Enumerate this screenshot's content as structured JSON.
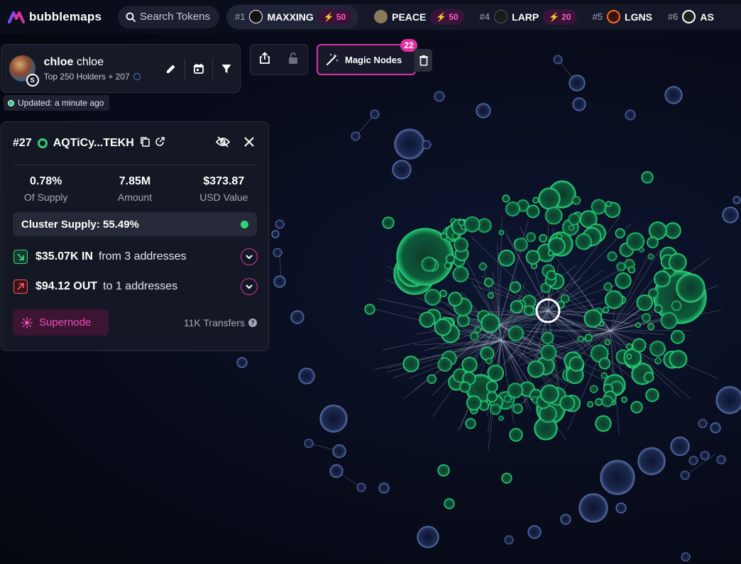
{
  "app": {
    "name": "bubblemaps",
    "search_placeholder": "Search Tokens"
  },
  "trending": [
    {
      "rank": "#1",
      "symbol": "MAXXING",
      "boost": "50",
      "logo_color": "#ffffff",
      "logo_bg": "#111111"
    },
    {
      "rank": "",
      "symbol": "PEACE",
      "boost": "50",
      "logo_color": "#c9b58a",
      "logo_bg": "#6a5e48"
    },
    {
      "rank": "#4",
      "symbol": "LARP",
      "boost": "20",
      "logo_color": "#ffffff",
      "logo_bg": "#1a1a1a"
    },
    {
      "rank": "#5",
      "symbol": "LGNS",
      "boost": "",
      "logo_color": "#ff6a2a",
      "logo_bg": "#3a1208"
    },
    {
      "rank": "#6",
      "symbol": "AS",
      "boost": "",
      "logo_color": "#ffffff",
      "logo_bg": "#222222"
    }
  ],
  "profile": {
    "name": "chloe",
    "ticker": "chloe",
    "subtitle": "Top 250 Holders + 207",
    "chain_badge": "S",
    "updated": "Updated: a minute ago"
  },
  "magic_nodes": {
    "label": "Magic Nodes",
    "count": "22"
  },
  "details": {
    "rank": "#27",
    "address": "AQTiCy...TEKH",
    "stats": [
      {
        "value": "0.78%",
        "label": "Of Supply"
      },
      {
        "value": "7.85M",
        "label": "Amount"
      },
      {
        "value": "$373.87",
        "label": "USD Value"
      }
    ],
    "cluster_supply": "Cluster Supply: 55.49%",
    "inflow": {
      "amount": "$35.07K IN",
      "text": "from 3 addresses"
    },
    "outflow": {
      "amount": "$94.12 OUT",
      "text": "to 1 addresses"
    },
    "supernode_label": "Supernode",
    "transfers": "11K Transfers"
  },
  "colors": {
    "accent": "#d631a9",
    "green": "#2ed47a",
    "bubble_blue": "#5a6fa8",
    "in_icon": "#3fd18a",
    "out_icon": "#f25a5a"
  }
}
